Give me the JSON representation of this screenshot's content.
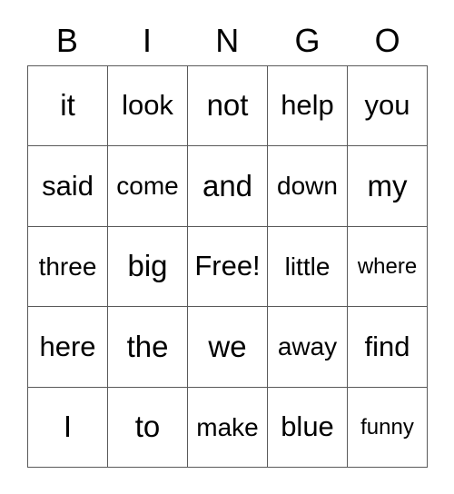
{
  "card": {
    "title": "BINGO",
    "columns": [
      "B",
      "I",
      "N",
      "G",
      "O"
    ],
    "free_space_label": "Free!",
    "colors": {
      "background": "#ffffff",
      "text": "#000000",
      "grid_line": "#5a5a5a"
    },
    "grid": {
      "rows": 5,
      "cols": 5,
      "cells": [
        [
          {
            "text": "it",
            "size": "fs-xl"
          },
          {
            "text": "look",
            "size": "fs-lg"
          },
          {
            "text": "not",
            "size": "fs-xl"
          },
          {
            "text": "help",
            "size": "fs-lg"
          },
          {
            "text": "you",
            "size": "fs-lg"
          }
        ],
        [
          {
            "text": "said",
            "size": "fs-lg"
          },
          {
            "text": "come",
            "size": "fs-md"
          },
          {
            "text": "and",
            "size": "fs-xl"
          },
          {
            "text": "down",
            "size": "fs-md"
          },
          {
            "text": "my",
            "size": "fs-xl"
          }
        ],
        [
          {
            "text": "three",
            "size": "fs-md"
          },
          {
            "text": "big",
            "size": "fs-xl"
          },
          {
            "text": "Free!",
            "size": "fs-lg"
          },
          {
            "text": "little",
            "size": "fs-md"
          },
          {
            "text": "where",
            "size": "fs-sm"
          }
        ],
        [
          {
            "text": "here",
            "size": "fs-lg"
          },
          {
            "text": "the",
            "size": "fs-xl"
          },
          {
            "text": "we",
            "size": "fs-xl"
          },
          {
            "text": "away",
            "size": "fs-md"
          },
          {
            "text": "find",
            "size": "fs-lg"
          }
        ],
        [
          {
            "text": "I",
            "size": "fs-xl"
          },
          {
            "text": "to",
            "size": "fs-xl"
          },
          {
            "text": "make",
            "size": "fs-md"
          },
          {
            "text": "blue",
            "size": "fs-lg"
          },
          {
            "text": "funny",
            "size": "fs-sm"
          }
        ]
      ]
    }
  }
}
